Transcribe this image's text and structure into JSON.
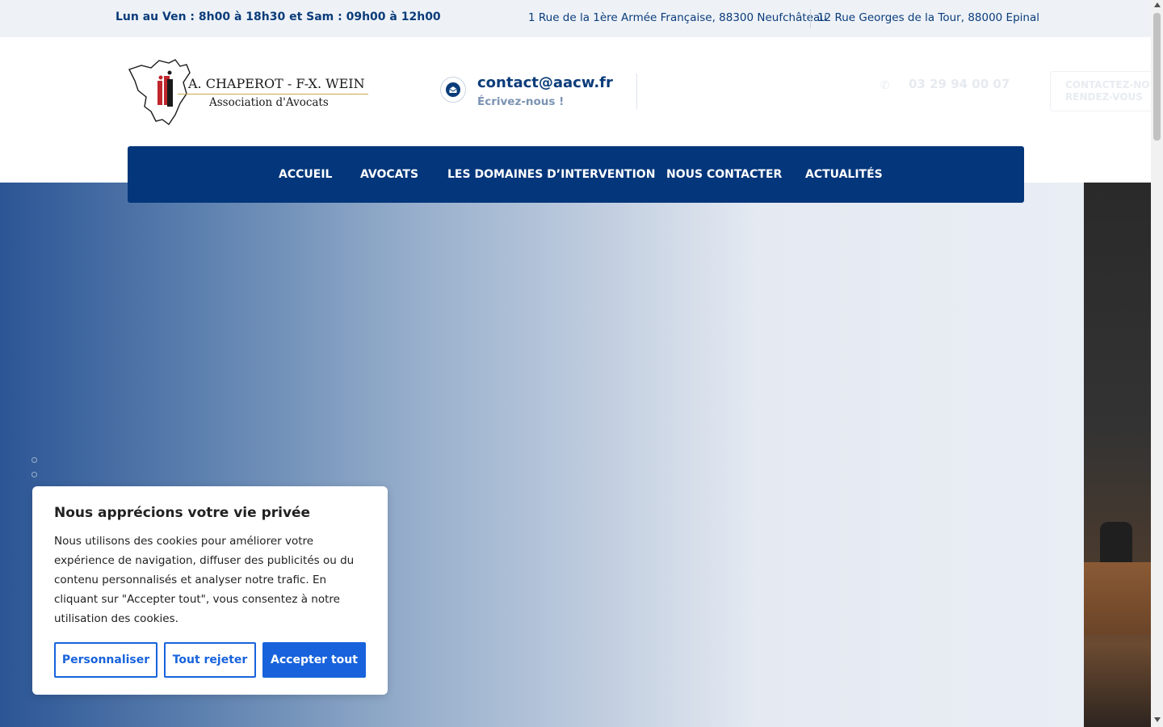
{
  "topbar": {
    "hours": "Lun au Ven : 8h00 à 18h30 et Sam : 09h00 à 12h00",
    "address_1": "1 Rue de la 1ère Armée Française, 88300 Neufchâteau",
    "address_2": "12 Rue Georges de la Tour, 88000 Epinal"
  },
  "logo": {
    "line1": "A. CHAPEROT - F-X. WEIN",
    "line2": "Association d'Avocats",
    "colors": {
      "red": "#c0262d",
      "dark": "#1a1a1a",
      "gold": "#c9a94a"
    }
  },
  "header": {
    "email": "contact@aacw.fr",
    "email_sub": "Écrivez-nous !",
    "phone": "03 29 94 00 07",
    "rdv_line1": "CONTACTEZ-NOUS",
    "rdv_line2": "RENDEZ-VOUS"
  },
  "nav": {
    "items": [
      "ACCUEIL",
      "AVOCATS",
      "LES DOMAINES D’INTERVENTION",
      "NOUS CONTACTER",
      "ACTUALITÉS"
    ],
    "bg_color": "#03367a"
  },
  "cookie": {
    "title": "Nous apprécions votre vie privée",
    "text": "Nous utilisons des cookies pour améliorer votre expérience de navigation, diffuser des publicités ou du contenu personnalisés et analyser notre trafic. En cliquant sur \"Accepter tout\", vous consentez à notre utilisation des cookies.",
    "btn_customize": "Personnaliser",
    "btn_reject": "Tout rejeter",
    "btn_accept": "Accepter tout",
    "accent": "#1863dc"
  },
  "icons": {
    "mail": "envelope-icon",
    "phone": "phone-icon"
  }
}
